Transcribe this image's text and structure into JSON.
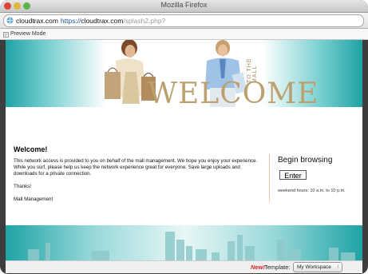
{
  "window": {
    "title": "Mozilla Firefox"
  },
  "address_bar": {
    "scheme": "https://",
    "domain": "cloudtrax.com",
    "path": "/splash2.php?"
  },
  "toolbar": {
    "preview_mode": "Preview Mode"
  },
  "banner": {
    "welcome": "WELCOME",
    "to_the_mall": "TO THE MALL"
  },
  "body": {
    "heading": "Welcome!",
    "paragraph1": "This network access is provided to you on behalf of the mall management. We hope you enjoy your experience. While you surf, please help us keep the network experience great for everyone. Save large uploads and downloads for a private connection.",
    "thanks": "Thanks!",
    "signature": "Mall Management"
  },
  "sidebar": {
    "begin_browsing": "Begin browsing",
    "enter_button": "Enter",
    "hours": "weekend hours: 10 a.m. to 10 p.m."
  },
  "footer": {
    "new_label": "New!",
    "template_label": "Template:",
    "template_value": "My Workspace"
  },
  "colors": {
    "teal": "#1fa3a6",
    "gold": "#bca070",
    "new_red": "#d22222"
  }
}
